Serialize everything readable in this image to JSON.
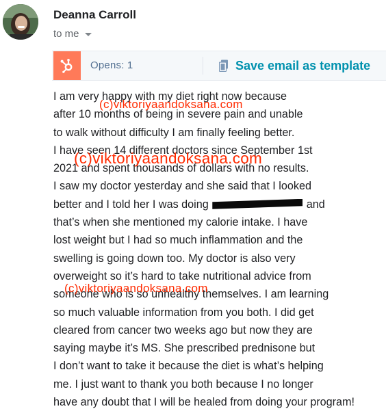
{
  "header": {
    "sender_name": "Deanna Carroll",
    "recipient_label": "to me"
  },
  "tracking": {
    "opens_label": "Opens: 1",
    "save_template_label": "Save email as template",
    "brand_color": "#ff7a59",
    "link_color": "#0091ae"
  },
  "message": {
    "lines": [
      "I am very happy with my diet right now because",
      "after 10 months of being in severe pain and unable",
      "to walk without difficulty I am finally feeling better.",
      "I have seen 14 different doctors since September 1st",
      "2021 and spent thousands of dollars with no results.",
      "I saw my doctor yesterday and she said that I looked",
      "better and I told her I was doing",
      "that’s when she mentioned my calorie intake. I have",
      "lost weight but I had so much inflammation and the",
      "swelling is going down too. My doctor is also very",
      "overweight so it’s hard to take nutritional advice from",
      "someone who is so unhealthy themselves. I am learning",
      "so much valuable information from you both. I did get",
      "cleared from cancer two weeks ago but now they are",
      "saying maybe it’s MS. She prescribed prednisone but",
      "I don’t want to take it because the diet is what’s helping",
      "me. I just want to thank you both because I no longer",
      "have any doubt that I will be healed from doing your program!"
    ],
    "redacted_suffix": "and"
  },
  "watermarks": {
    "text_1": "(c)viktoriyaandoksana.com",
    "text_2": "(c)viktoriyaandoksana.com",
    "text_3": "(c)viktoriyaandoksana.com"
  }
}
